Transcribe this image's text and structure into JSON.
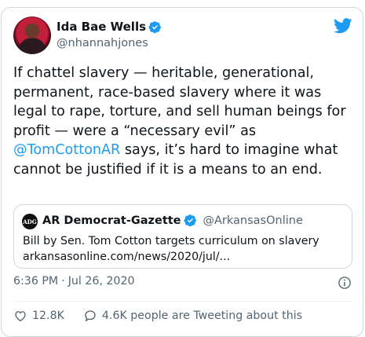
{
  "author": {
    "display_name": "Ida Bae Wells",
    "handle": "@nhannahjones"
  },
  "tweet": {
    "text_before": "If chattel slavery — heritable, generational, permanent, race-based slavery where it was legal to rape, torture, and sell human beings for profit — were a “necessary evil” as ",
    "mention": "@TomCottonAR",
    "text_after": " says, it’s hard to imagine what cannot be justified if it is a means to an end."
  },
  "quote": {
    "logo_text": "ADG",
    "display_name": "AR Democrat-Gazette",
    "handle": "@ArkansasOnline",
    "line1": "Bill by Sen. Tom Cotton targets curriculum on slavery",
    "line2": "arkansasonline.com/news/2020/jul/..."
  },
  "meta": {
    "time": "6:36 PM",
    "separator": "·",
    "date": "Jul 26, 2020"
  },
  "actions": {
    "likes": "12.8K",
    "replies_text": "4.6K people are Tweeting about this"
  },
  "colors": {
    "accent": "#1d9bf0",
    "text": "#0f1419",
    "secondary": "#536471",
    "border": "#cfd9de"
  },
  "icons": [
    "verified-badge-icon",
    "twitter-bird-icon",
    "info-icon",
    "heart-icon",
    "comment-icon"
  ]
}
